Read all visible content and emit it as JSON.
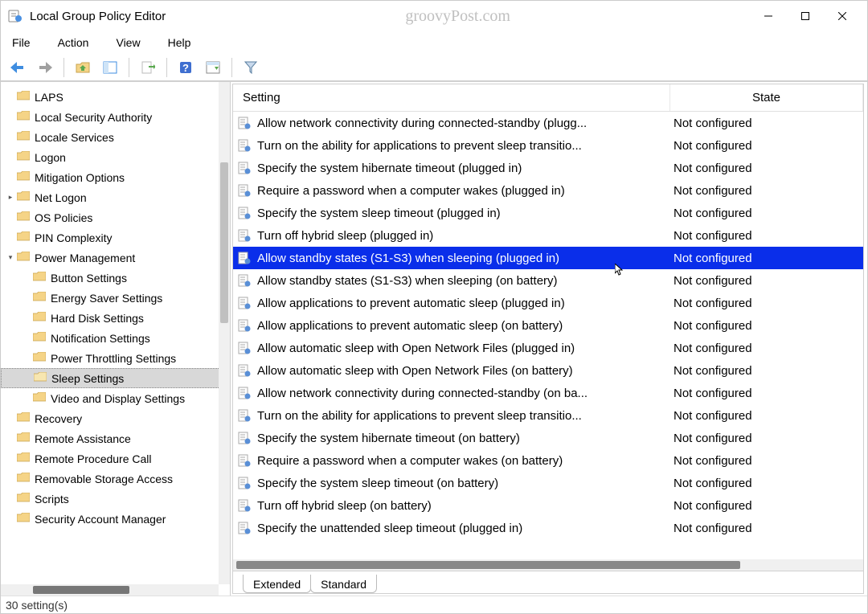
{
  "window": {
    "title": "Local Group Policy Editor",
    "watermark": "groovyPost.com"
  },
  "menus": {
    "file": "File",
    "action": "Action",
    "view": "View",
    "help": "Help"
  },
  "toolbar_icons": [
    "back",
    "forward",
    "|",
    "up-folder",
    "details-pane",
    "|",
    "export",
    "|",
    "help",
    "properties",
    "|",
    "filter"
  ],
  "tree": {
    "items": [
      {
        "label": "LAPS",
        "indent": 0,
        "exp": ""
      },
      {
        "label": "Local Security Authority",
        "indent": 0,
        "exp": ""
      },
      {
        "label": "Locale Services",
        "indent": 0,
        "exp": ""
      },
      {
        "label": "Logon",
        "indent": 0,
        "exp": ""
      },
      {
        "label": "Mitigation Options",
        "indent": 0,
        "exp": ""
      },
      {
        "label": "Net Logon",
        "indent": 0,
        "exp": ">"
      },
      {
        "label": "OS Policies",
        "indent": 0,
        "exp": ""
      },
      {
        "label": "PIN Complexity",
        "indent": 0,
        "exp": ""
      },
      {
        "label": "Power Management",
        "indent": 0,
        "exp": "v"
      },
      {
        "label": "Button Settings",
        "indent": 1,
        "exp": ""
      },
      {
        "label": "Energy Saver Settings",
        "indent": 1,
        "exp": ""
      },
      {
        "label": "Hard Disk Settings",
        "indent": 1,
        "exp": ""
      },
      {
        "label": "Notification Settings",
        "indent": 1,
        "exp": ""
      },
      {
        "label": "Power Throttling Settings",
        "indent": 1,
        "exp": ""
      },
      {
        "label": "Sleep Settings",
        "indent": 1,
        "exp": "",
        "selected": true
      },
      {
        "label": "Video and Display Settings",
        "indent": 1,
        "exp": ""
      },
      {
        "label": "Recovery",
        "indent": 0,
        "exp": ""
      },
      {
        "label": "Remote Assistance",
        "indent": 0,
        "exp": ""
      },
      {
        "label": "Remote Procedure Call",
        "indent": 0,
        "exp": ""
      },
      {
        "label": "Removable Storage Access",
        "indent": 0,
        "exp": ""
      },
      {
        "label": "Scripts",
        "indent": 0,
        "exp": ""
      },
      {
        "label": "Security Account Manager",
        "indent": 0,
        "exp": ""
      }
    ]
  },
  "columns": {
    "setting": "Setting",
    "state": "State"
  },
  "settings": [
    {
      "name": "Allow network connectivity during connected-standby (plugg...",
      "state": "Not configured"
    },
    {
      "name": "Turn on the ability for applications to prevent sleep transitio...",
      "state": "Not configured"
    },
    {
      "name": "Specify the system hibernate timeout (plugged in)",
      "state": "Not configured"
    },
    {
      "name": "Require a password when a computer wakes (plugged in)",
      "state": "Not configured"
    },
    {
      "name": "Specify the system sleep timeout (plugged in)",
      "state": "Not configured"
    },
    {
      "name": "Turn off hybrid sleep (plugged in)",
      "state": "Not configured"
    },
    {
      "name": "Allow standby states (S1-S3) when sleeping (plugged in)",
      "state": "Not configured",
      "selected": true
    },
    {
      "name": "Allow standby states (S1-S3) when sleeping (on battery)",
      "state": "Not configured"
    },
    {
      "name": "Allow applications to prevent automatic sleep (plugged in)",
      "state": "Not configured"
    },
    {
      "name": "Allow applications to prevent automatic sleep (on battery)",
      "state": "Not configured"
    },
    {
      "name": "Allow automatic sleep with Open Network Files (plugged in)",
      "state": "Not configured"
    },
    {
      "name": "Allow automatic sleep with Open Network Files (on battery)",
      "state": "Not configured"
    },
    {
      "name": "Allow network connectivity during connected-standby (on ba...",
      "state": "Not configured"
    },
    {
      "name": "Turn on the ability for applications to prevent sleep transitio...",
      "state": "Not configured"
    },
    {
      "name": "Specify the system hibernate timeout (on battery)",
      "state": "Not configured"
    },
    {
      "name": "Require a password when a computer wakes (on battery)",
      "state": "Not configured"
    },
    {
      "name": "Specify the system sleep timeout (on battery)",
      "state": "Not configured"
    },
    {
      "name": "Turn off hybrid sleep (on battery)",
      "state": "Not configured"
    },
    {
      "name": "Specify the unattended sleep timeout (plugged in)",
      "state": "Not configured"
    }
  ],
  "tabs": {
    "extended": "Extended",
    "standard": "Standard",
    "active": "standard"
  },
  "status": "30 setting(s)"
}
